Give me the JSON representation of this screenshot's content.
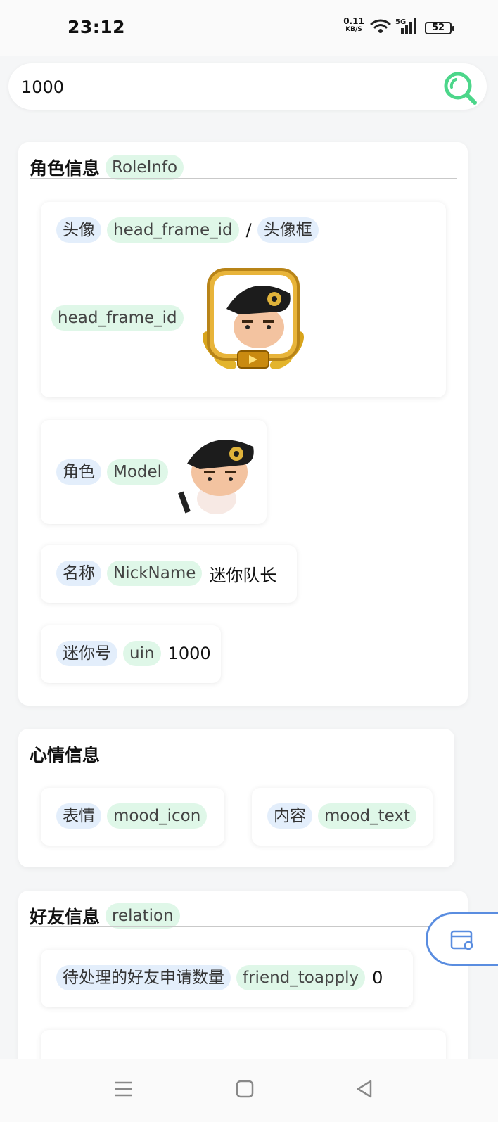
{
  "status_bar": {
    "time": "23:12",
    "net_speed_value": "0.11",
    "net_speed_unit": "KB/S",
    "network": "5G",
    "battery": "52"
  },
  "search": {
    "value": "1000",
    "icon": "search-icon"
  },
  "role_info": {
    "title": "角色信息",
    "key": "RoleInfo",
    "head": {
      "label": "头像",
      "key": "head_frame_id",
      "separator": "/",
      "label2": "头像框",
      "inner_key": "head_frame_id"
    },
    "model": {
      "label": "角色",
      "key": "Model"
    },
    "nickname": {
      "label": "名称",
      "key": "NickName",
      "value": "迷你队长"
    },
    "uin": {
      "label": "迷你号",
      "key": "uin",
      "value": "1000"
    }
  },
  "mood_info": {
    "title": "心情信息",
    "icon": {
      "label": "表情",
      "key": "mood_icon"
    },
    "text": {
      "label": "内容",
      "key": "mood_text"
    }
  },
  "friend_info": {
    "title": "好友信息",
    "key": "relation",
    "toapply": {
      "label": "待处理的好友申请数量",
      "key": "friend_toapply",
      "value": "0"
    }
  },
  "colors": {
    "accent_green": "#4cd68a",
    "tag_blue_bg": "#e3eefb",
    "tag_green_bg": "#dff7e8",
    "float_border": "#5a8de0"
  },
  "nav": {
    "icons": [
      "menu-icon",
      "home-icon",
      "back-icon"
    ]
  }
}
